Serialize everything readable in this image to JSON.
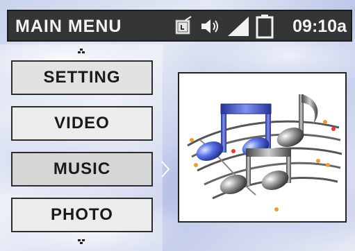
{
  "header": {
    "title": "MAIN MENU",
    "time": "09:10a",
    "status_icons": [
      "sd-card-icon",
      "speaker-icon",
      "signal-icon",
      "battery-icon"
    ]
  },
  "menu": {
    "items": [
      {
        "label": "SETTING"
      },
      {
        "label": "VIDEO"
      },
      {
        "label": "MUSIC",
        "selected": true
      },
      {
        "label": "PHOTO"
      }
    ]
  },
  "preview": {
    "icon": "music-notes-icon"
  },
  "colors": {
    "header_bg": "#333537",
    "header_text": "#f2f2f2",
    "note_blue": "#3a4fc8",
    "note_gray": "#6e6e6e"
  }
}
